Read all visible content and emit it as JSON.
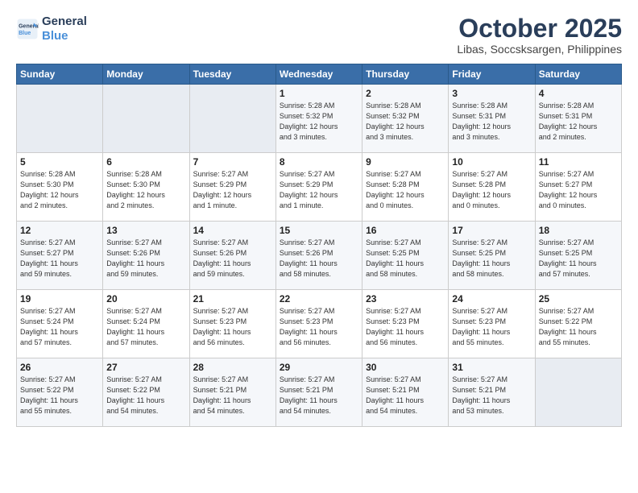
{
  "logo": {
    "line1": "General",
    "line2": "Blue"
  },
  "title": "October 2025",
  "location": "Libas, Soccsksargen, Philippines",
  "days_of_week": [
    "Sunday",
    "Monday",
    "Tuesday",
    "Wednesday",
    "Thursday",
    "Friday",
    "Saturday"
  ],
  "weeks": [
    [
      {
        "day": "",
        "text": ""
      },
      {
        "day": "",
        "text": ""
      },
      {
        "day": "",
        "text": ""
      },
      {
        "day": "1",
        "text": "Sunrise: 5:28 AM\nSunset: 5:32 PM\nDaylight: 12 hours\nand 3 minutes."
      },
      {
        "day": "2",
        "text": "Sunrise: 5:28 AM\nSunset: 5:32 PM\nDaylight: 12 hours\nand 3 minutes."
      },
      {
        "day": "3",
        "text": "Sunrise: 5:28 AM\nSunset: 5:31 PM\nDaylight: 12 hours\nand 3 minutes."
      },
      {
        "day": "4",
        "text": "Sunrise: 5:28 AM\nSunset: 5:31 PM\nDaylight: 12 hours\nand 2 minutes."
      }
    ],
    [
      {
        "day": "5",
        "text": "Sunrise: 5:28 AM\nSunset: 5:30 PM\nDaylight: 12 hours\nand 2 minutes."
      },
      {
        "day": "6",
        "text": "Sunrise: 5:28 AM\nSunset: 5:30 PM\nDaylight: 12 hours\nand 2 minutes."
      },
      {
        "day": "7",
        "text": "Sunrise: 5:27 AM\nSunset: 5:29 PM\nDaylight: 12 hours\nand 1 minute."
      },
      {
        "day": "8",
        "text": "Sunrise: 5:27 AM\nSunset: 5:29 PM\nDaylight: 12 hours\nand 1 minute."
      },
      {
        "day": "9",
        "text": "Sunrise: 5:27 AM\nSunset: 5:28 PM\nDaylight: 12 hours\nand 0 minutes."
      },
      {
        "day": "10",
        "text": "Sunrise: 5:27 AM\nSunset: 5:28 PM\nDaylight: 12 hours\nand 0 minutes."
      },
      {
        "day": "11",
        "text": "Sunrise: 5:27 AM\nSunset: 5:27 PM\nDaylight: 12 hours\nand 0 minutes."
      }
    ],
    [
      {
        "day": "12",
        "text": "Sunrise: 5:27 AM\nSunset: 5:27 PM\nDaylight: 11 hours\nand 59 minutes."
      },
      {
        "day": "13",
        "text": "Sunrise: 5:27 AM\nSunset: 5:26 PM\nDaylight: 11 hours\nand 59 minutes."
      },
      {
        "day": "14",
        "text": "Sunrise: 5:27 AM\nSunset: 5:26 PM\nDaylight: 11 hours\nand 59 minutes."
      },
      {
        "day": "15",
        "text": "Sunrise: 5:27 AM\nSunset: 5:26 PM\nDaylight: 11 hours\nand 58 minutes."
      },
      {
        "day": "16",
        "text": "Sunrise: 5:27 AM\nSunset: 5:25 PM\nDaylight: 11 hours\nand 58 minutes."
      },
      {
        "day": "17",
        "text": "Sunrise: 5:27 AM\nSunset: 5:25 PM\nDaylight: 11 hours\nand 58 minutes."
      },
      {
        "day": "18",
        "text": "Sunrise: 5:27 AM\nSunset: 5:25 PM\nDaylight: 11 hours\nand 57 minutes."
      }
    ],
    [
      {
        "day": "19",
        "text": "Sunrise: 5:27 AM\nSunset: 5:24 PM\nDaylight: 11 hours\nand 57 minutes."
      },
      {
        "day": "20",
        "text": "Sunrise: 5:27 AM\nSunset: 5:24 PM\nDaylight: 11 hours\nand 57 minutes."
      },
      {
        "day": "21",
        "text": "Sunrise: 5:27 AM\nSunset: 5:23 PM\nDaylight: 11 hours\nand 56 minutes."
      },
      {
        "day": "22",
        "text": "Sunrise: 5:27 AM\nSunset: 5:23 PM\nDaylight: 11 hours\nand 56 minutes."
      },
      {
        "day": "23",
        "text": "Sunrise: 5:27 AM\nSunset: 5:23 PM\nDaylight: 11 hours\nand 56 minutes."
      },
      {
        "day": "24",
        "text": "Sunrise: 5:27 AM\nSunset: 5:23 PM\nDaylight: 11 hours\nand 55 minutes."
      },
      {
        "day": "25",
        "text": "Sunrise: 5:27 AM\nSunset: 5:22 PM\nDaylight: 11 hours\nand 55 minutes."
      }
    ],
    [
      {
        "day": "26",
        "text": "Sunrise: 5:27 AM\nSunset: 5:22 PM\nDaylight: 11 hours\nand 55 minutes."
      },
      {
        "day": "27",
        "text": "Sunrise: 5:27 AM\nSunset: 5:22 PM\nDaylight: 11 hours\nand 54 minutes."
      },
      {
        "day": "28",
        "text": "Sunrise: 5:27 AM\nSunset: 5:21 PM\nDaylight: 11 hours\nand 54 minutes."
      },
      {
        "day": "29",
        "text": "Sunrise: 5:27 AM\nSunset: 5:21 PM\nDaylight: 11 hours\nand 54 minutes."
      },
      {
        "day": "30",
        "text": "Sunrise: 5:27 AM\nSunset: 5:21 PM\nDaylight: 11 hours\nand 54 minutes."
      },
      {
        "day": "31",
        "text": "Sunrise: 5:27 AM\nSunset: 5:21 PM\nDaylight: 11 hours\nand 53 minutes."
      },
      {
        "day": "",
        "text": ""
      }
    ]
  ]
}
